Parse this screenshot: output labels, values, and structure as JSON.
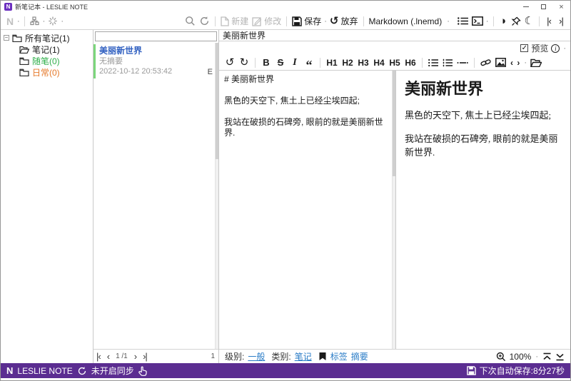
{
  "colors": {
    "statusbar_purple": "#5b2d91",
    "link_blue": "#2a7cc7",
    "note_title_blue": "#2f5fc0",
    "folder_green": "#2faf4a",
    "folder_orange": "#e5792a",
    "note_accent_green": "#7bd67b"
  },
  "titlebar": {
    "logo": "N",
    "title": "新笔记本 - LESLIE NOTE"
  },
  "window_controls": {
    "close": "×"
  },
  "toolbar": {
    "logo": "N",
    "new": "新建",
    "modify": "修改",
    "save": "保存",
    "discard": "放弃",
    "format": "Markdown  (.lnemd)"
  },
  "icons": {
    "dropdown_dot": "·",
    "undo": "↺",
    "redo": "↻",
    "discard_arrow": "↺",
    "contrast": "◑",
    "moon": "☾",
    "collapse_left": "|‹",
    "collapse_right": "›|",
    "quote": "“",
    "code": "‹ ›",
    "info": "i",
    "check": "✓",
    "expander": "−"
  },
  "sidebar": {
    "items": [
      {
        "label": "所有笔记(1)"
      },
      {
        "label": "笔记(1)"
      },
      {
        "label": "随笔(0)"
      },
      {
        "label": "日常(0)"
      }
    ]
  },
  "note_list": {
    "search_value": "",
    "item": {
      "title": "美丽新世界",
      "summary": "无摘要",
      "date": "2022-10-12 20:53:42",
      "badge": "E"
    },
    "pagination": {
      "first": "|‹",
      "prev": "‹",
      "page": "1 /1",
      "next": "›",
      "last": "›|"
    },
    "count": "1"
  },
  "editor": {
    "title": "美丽新世界",
    "preview_label": "预览",
    "md_toolbar": {
      "bold": "B",
      "strike": "S",
      "italic": "I",
      "h": [
        "H1",
        "H2",
        "H3",
        "H4",
        "H5",
        "H6"
      ]
    },
    "source_lines": [
      "# 美丽新世界",
      "",
      "黑色的天空下, 焦土上已经尘埃四起;",
      "",
      "我站在破损的石碑旁, 眼前的就是美丽新世界."
    ],
    "preview": {
      "heading": "美丽新世界",
      "p1": "黑色的天空下, 焦土上已经尘埃四起;",
      "p2": "我站在破损的石碑旁, 眼前的就是美丽新世界."
    },
    "footer": {
      "level_label": "级别:",
      "level_value": "一般",
      "category_label": "类别:",
      "category_value": "笔记",
      "tags": "标签",
      "summary": "摘要",
      "zoom": "100%"
    }
  },
  "statusbar": {
    "logo": "N",
    "app": "LESLIE NOTE",
    "sync": "未开启同步",
    "autosave": "下次自动保存:8分27秒"
  }
}
